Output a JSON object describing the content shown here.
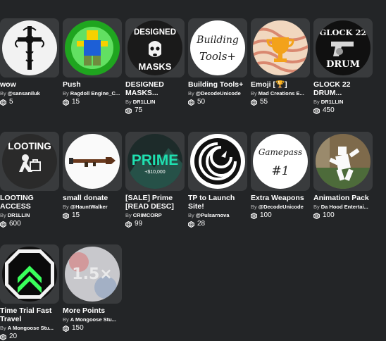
{
  "by_label": "By",
  "items": [
    {
      "title": "wow",
      "creator": "@sansaniluk",
      "price": "5",
      "art": "cross",
      "thumb_text": ""
    },
    {
      "title": "Push",
      "creator": "Ragdoll Engine_C...",
      "price": "15",
      "art": "avatar",
      "thumb_text": ""
    },
    {
      "title": "DESIGNED MASKS...",
      "creator": "DR1LLIN",
      "price": "75",
      "art": "masks",
      "thumb_text": "DESIGNED\nMASKS"
    },
    {
      "title": "Building Tools+",
      "creator": "@DecodeUnicode",
      "price": "50",
      "art": "handwritten",
      "thumb_text": "Building\nTools+"
    },
    {
      "title": "Emoji [🏆]",
      "creator": "Mad Creations E...",
      "price": "55",
      "art": "trophy",
      "thumb_text": ""
    },
    {
      "title": "GLOCK 22 DRUM...",
      "creator": "DR1LLIN",
      "price": "450",
      "art": "glock",
      "thumb_text": "GLOCK 22\nDRUM"
    },
    {
      "title": "LOOTING ACCESS",
      "creator": "DR1LLIN",
      "price": "600",
      "art": "looting",
      "thumb_text": "LOOTING"
    },
    {
      "title": "small donate",
      "creator": "@HauntWalker",
      "price": "15",
      "art": "rpg",
      "thumb_text": ""
    },
    {
      "title": "[SALE] Prime [READ DESC]",
      "creator": "CRIMCORP",
      "price": "99",
      "art": "prime",
      "thumb_text": "PRIME\n+$10,000"
    },
    {
      "title": "TP to Launch Site!",
      "creator": "@Pulsarnova",
      "price": "28",
      "art": "rocket",
      "thumb_text": ""
    },
    {
      "title": "Extra Weapons",
      "creator": "@DecodeUnicode",
      "price": "100",
      "art": "gamepass",
      "thumb_text": "Gamepass\n#1"
    },
    {
      "title": "Animation Pack",
      "creator": "Da Hood Entertai...",
      "price": "100",
      "art": "animation",
      "thumb_text": ""
    },
    {
      "title": "Time Trial Fast Travel",
      "creator": "A Mongoose Stu...",
      "price": "20",
      "art": "chevron",
      "thumb_text": ""
    },
    {
      "title": "More Points",
      "creator": "A Mongoose Stu...",
      "price": "150",
      "art": "points",
      "thumb_text": "1.5×"
    }
  ]
}
